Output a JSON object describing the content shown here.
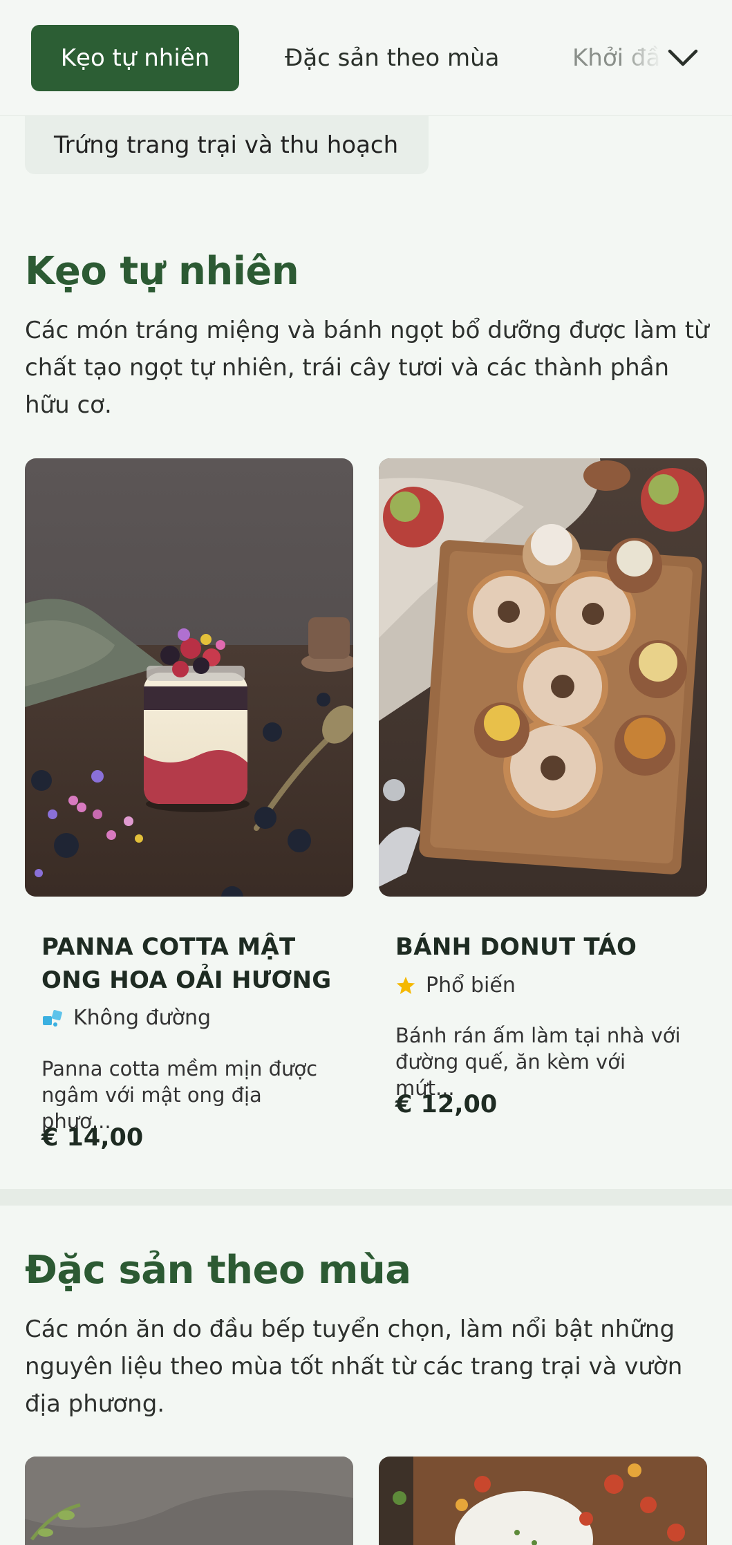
{
  "tabs": {
    "active": "Kẹo tự nhiên",
    "second": "Đặc sản theo mùa",
    "third": "Khởi đầu"
  },
  "pill": {
    "label": "Trứng trang trại và thu hoạch"
  },
  "sections": [
    {
      "title": "Kẹo tự nhiên",
      "description": "Các món tráng miệng và bánh ngọt bổ dưỡng được làm từ chất tạo ngọt tự nhiên, trái cây tươi và các thành phần hữu cơ.",
      "cards": [
        {
          "title": "PANNA COTTA MẬT ONG HOA OẢI HƯƠNG",
          "badge": "Không đường",
          "badge_icon": "sugar-cubes-icon",
          "description": "Panna cotta mềm mịn được ngâm với mật ong địa phươ...",
          "price": "€ 14,00"
        },
        {
          "title": "BÁNH DONUT TÁO",
          "badge": "Phổ biến",
          "badge_icon": "star-icon",
          "description": "Bánh rán ấm làm tại nhà với đường quế, ăn kèm với mứt...",
          "price": "€ 12,00"
        }
      ]
    },
    {
      "title": "Đặc sản theo mùa",
      "description": "Các món ăn do đầu bếp tuyển chọn, làm nổi bật những nguyên liệu theo mùa tốt nhất từ các trang trại và vườn địa phương."
    }
  ],
  "colors": {
    "brand_green": "#2c5e34",
    "title_green": "#2c5a33",
    "background": "#f3f7f3",
    "star": "#f5b800",
    "sugar_icon": "#3ab0e0"
  }
}
